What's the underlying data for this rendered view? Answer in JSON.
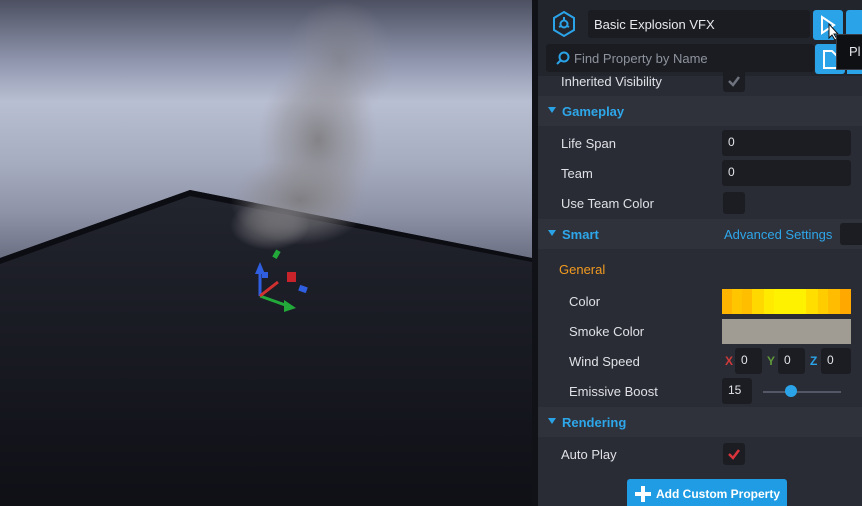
{
  "header": {
    "object_name": "Basic Explosion VFX",
    "search_placeholder": "Find Property by Name",
    "tooltip_text": "Pl"
  },
  "properties": {
    "inherited_visibility_label": "Inherited Visibility",
    "inherited_visibility_checked": true,
    "gameplay": {
      "title": "Gameplay",
      "life_span_label": "Life Span",
      "life_span_value": "0",
      "team_label": "Team",
      "team_value": "0",
      "use_team_color_label": "Use Team Color",
      "use_team_color_checked": false
    },
    "smart": {
      "title": "Smart",
      "advanced_settings_label": "Advanced Settings",
      "general_label": "General",
      "color_label": "Color",
      "color_value": "#ffd000",
      "smoke_color_label": "Smoke Color",
      "smoke_color_value": "#a09b93",
      "wind_speed_label": "Wind Speed",
      "wind_x_label": "X",
      "wind_x_value": "0",
      "wind_y_label": "Y",
      "wind_y_value": "0",
      "wind_z_label": "Z",
      "wind_z_value": "0",
      "emissive_boost_label": "Emissive Boost",
      "emissive_boost_value": "15",
      "emissive_boost_fraction": 0.3
    },
    "rendering": {
      "title": "Rendering",
      "auto_play_label": "Auto Play",
      "auto_play_checked": true
    }
  },
  "footer": {
    "add_custom_property_label": "Add Custom Property"
  },
  "colors": {
    "accent": "#2aa3e8",
    "subheading": "#f09a20",
    "x_axis": "#d03a3a",
    "y_axis": "#5f9a3a",
    "z_axis": "#2aa3e8",
    "check_red": "#d9343b"
  }
}
